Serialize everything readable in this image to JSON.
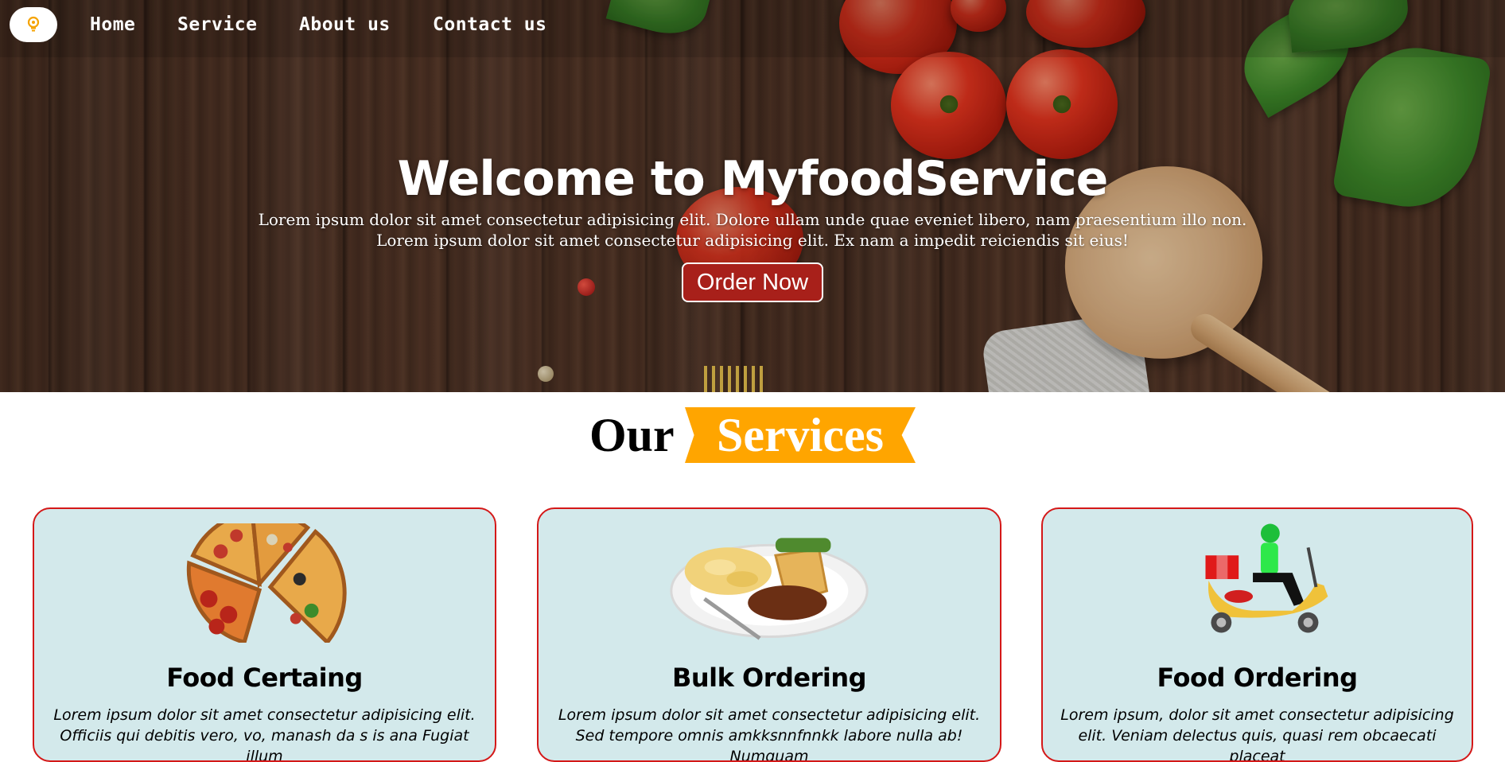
{
  "nav": {
    "logo_icon": "lightbulb-icon",
    "links": [
      "Home",
      "Service",
      "About us",
      "Contact us"
    ]
  },
  "hero": {
    "title": "Welcome to MyfoodService",
    "subtitle_line1": "Lorem ipsum dolor sit amet consectetur adipisicing elit. Dolore ullam unde quae eveniet libero, nam praesentium illo non.",
    "subtitle_line2": "Lorem ipsum dolor sit amet consectetur adipisicing elit. Ex nam a impedit reiciendis sit eius!",
    "cta_label": "Order Now"
  },
  "services": {
    "heading_plain": "Our",
    "heading_highlight": "Services",
    "cards": [
      {
        "title": "Food Certaing",
        "text": "Lorem ipsum dolor sit amet consectetur adipisicing elit. Officiis qui debitis vero, vo, manash da s is ana Fugiat illum",
        "image": "pizza-slices-image"
      },
      {
        "title": "Bulk Ordering",
        "text": "Lorem ipsum dolor sit amet consectetur adipisicing elit. Sed tempore omnis amkksnnfnnkk labore nulla ab! Numquam",
        "image": "pie-plate-image"
      },
      {
        "title": "Food Ordering",
        "text": "Lorem ipsum, dolor sit amet consectetur adipisicing elit. Veniam delectus quis, quasi rem obcaecati placeat",
        "image": "delivery-scooter-image"
      }
    ]
  },
  "colors": {
    "order_button": "#a8201a",
    "ribbon": "#ffa500",
    "card_background": "#d3e9eb",
    "card_border": "#d41818"
  }
}
